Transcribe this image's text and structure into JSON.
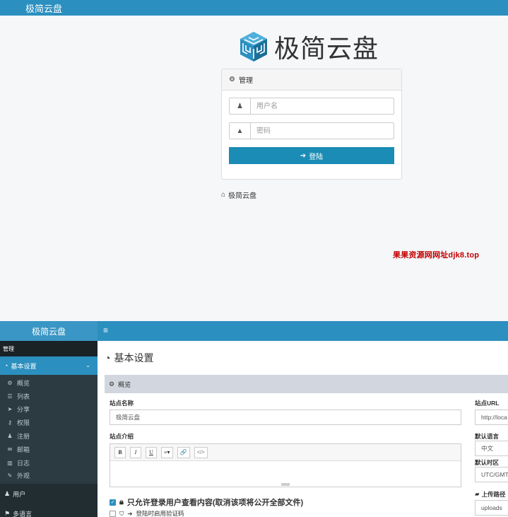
{
  "login": {
    "brand": "极简云盘",
    "logo_text": "极简云盘",
    "panel_title": "管理",
    "username_placeholder": "用户名",
    "password_placeholder": "密码",
    "login_button": "登陆",
    "home_link": "极简云盘",
    "watermark": "果果资源网网址djk8.top",
    "colors": {
      "header": "#2b8fbf",
      "button": "#1a8cb5"
    }
  },
  "admin": {
    "brand": "极简云盘",
    "hamburger": "≡",
    "sidebar": {
      "section_title": "管理",
      "active_item": "基本设置",
      "sub_items": [
        {
          "label": "概览",
          "icon": "gears-icon"
        },
        {
          "label": "列表",
          "icon": "list-icon"
        },
        {
          "label": "分享",
          "icon": "paper-plane-icon"
        },
        {
          "label": "权限",
          "icon": "key-icon"
        },
        {
          "label": "注册",
          "icon": "user-plus-icon"
        },
        {
          "label": "邮箱",
          "icon": "envelope-icon"
        },
        {
          "label": "日志",
          "icon": "bar-chart-icon"
        },
        {
          "label": "外观",
          "icon": "pen-icon"
        }
      ],
      "items": [
        {
          "label": "用户",
          "icon": "users-icon"
        },
        {
          "label": "多语言",
          "icon": "language-icon"
        }
      ]
    },
    "page_title": "基本设置",
    "box_title": "概览",
    "fields": {
      "site_name_label": "站点名称",
      "site_name_value": "极简云盘",
      "site_intro_label": "站点介绍",
      "site_url_label": "站点URL",
      "site_url_value": "http://loca",
      "language_label": "默认语言",
      "language_value": "中文",
      "timezone_label": "默认时区",
      "timezone_value": "UTC/GMT",
      "upload_label": "上传路径",
      "upload_value": "uploads"
    },
    "editor_buttons": [
      "B",
      "I",
      "U",
      "≡▾",
      "🔗",
      "</>"
    ],
    "checks": [
      {
        "label": "只允许登录用户查看内容(取消该项将公开全部文件)",
        "checked": true
      },
      {
        "label": "登陆时启用验证码",
        "checked": false
      }
    ]
  }
}
